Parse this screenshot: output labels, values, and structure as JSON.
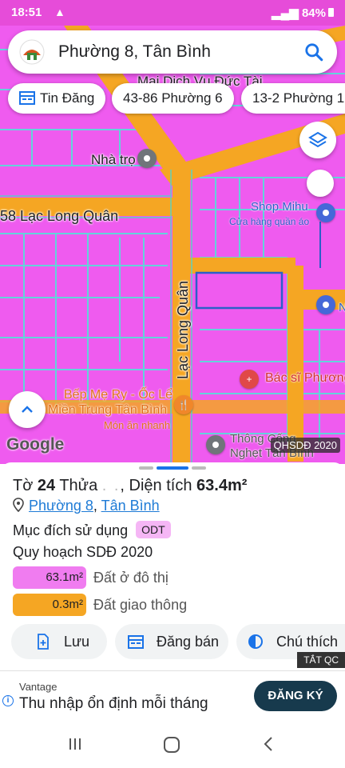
{
  "status": {
    "time": "18:51",
    "battery": "84%"
  },
  "search": {
    "text": "Phường 8, Tân Bình"
  },
  "chips": [
    "Tin Đăng",
    "43-86 Phường 6",
    "13-2 Phường 1"
  ],
  "map": {
    "labels": {
      "mai_dich_vu": "Mai Dịch Vụ Đức Tài",
      "nha_tro": "Nhà trọ",
      "lac_long_quan_left": "58 Lạc Long Quân",
      "lac_long_quan_vertical": "Lạc Long Quân",
      "shop_mihu": "Shop Mihu",
      "cua_hang": "Cửa hàng quần áo",
      "n_label": "N",
      "bac_si": "Bác sĩ Phương",
      "bep_me_ry_1": "Bếp Mẹ Ry - Ốc Lể",
      "bep_me_ry_2": "Miền Trung Tân Bình",
      "mon_an_nhanh": "Món ăn nhanh",
      "thong_cong_1": "Thông Cống",
      "thong_cong_2": "Nghẹt Tân Bình"
    },
    "google": "Google",
    "qh_badge": "QHSDĐ 2020"
  },
  "sheet": {
    "title_prefix": "Tờ ",
    "to_number": "24",
    "title_mid": " Thửa ",
    "title_area": ", Diện tích ",
    "area": "63.4m²",
    "location_ward": "Phường 8",
    "location_sep": ",",
    "location_district": "Tân Bình",
    "purpose_label": "Mục đích sử dụng",
    "purpose_code": "ODT",
    "plan_label": "Quy hoạch SDĐ 2020",
    "legend": [
      {
        "value": "63.1m²",
        "label": "Đất ở đô thị",
        "color": "#f07cf0"
      },
      {
        "value": "0.3m²",
        "label": "Đất giao thông",
        "color": "#f5a623"
      }
    ],
    "buttons": {
      "save": "Lưu",
      "post": "Đăng bán",
      "legend": "Chú thích"
    }
  },
  "ad": {
    "tag": "TẮT QC",
    "brand": "Vantage",
    "message": "Thu nhập ổn định mỗi tháng",
    "cta": "ĐĂNG KÝ"
  },
  "colors": {
    "land": "#ef5bef",
    "road": "#f5a623",
    "accent": "#1a73e8"
  }
}
